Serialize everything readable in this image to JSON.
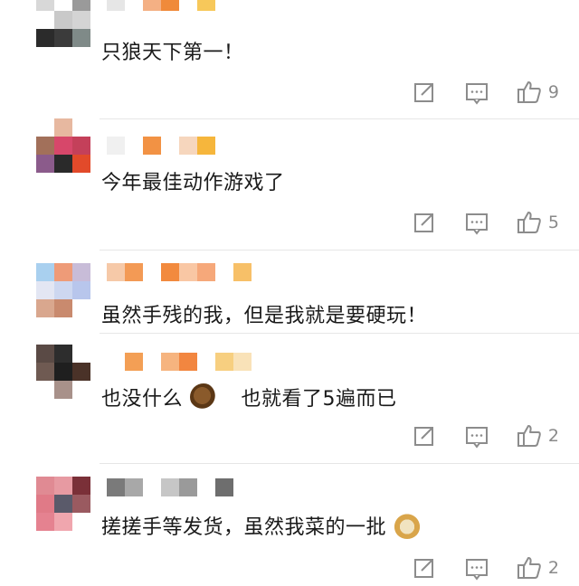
{
  "comments": [
    {
      "text": "只狼天下第一！",
      "like_count": "9",
      "emoji": "",
      "text_after": "",
      "avatar": [
        "#d8d8d8",
        "#ffffff",
        "#9a9a9a",
        "#ffffff",
        "#c9c9c9",
        "#d4d4d4",
        "#2b2b2b",
        "#3b3b3b",
        "#7f8a88"
      ],
      "name_colors": [
        "#e6e6e6",
        "#ffffff",
        "#f4b084",
        "#f08a3a",
        "#ffffff",
        "#f7c85a"
      ]
    },
    {
      "text": "今年最佳动作游戏了",
      "like_count": "5",
      "emoji": "",
      "text_after": "",
      "avatar": [
        "#ffffff",
        "#e7b8a0",
        "#ffffff",
        "#a2705a",
        "#d7476a",
        "#c4405a",
        "#8b5b8b",
        "#2a2a2a",
        "#e24a2a"
      ],
      "name_colors": [
        "#f0f0f0",
        "#ffffff",
        "#f29244",
        "#ffffff",
        "#f6d6bd",
        "#f6b63c"
      ]
    },
    {
      "text": "虽然手残的我，但是我就是要硬玩！",
      "like_count": "",
      "emoji": "",
      "text_after": "",
      "avatar": [
        "#a9d0ef",
        "#ee9b78",
        "#c8bcd8",
        "#e3e6f3",
        "#cdd7f0",
        "#b8c6ec",
        "#d9a78e",
        "#c98a6e",
        "#ffffff"
      ],
      "name_colors": [
        "#f6c9a8",
        "#f39a55",
        "#ffffff",
        "#f28a3e",
        "#f9c7a4",
        "#f6a87a",
        "#ffffff",
        "#f7c068"
      ]
    },
    {
      "text": "也没什么",
      "like_count": "2",
      "emoji": "horse",
      "text_after": "也就看了5遍而已",
      "avatar": [
        "#5a4a45",
        "#2d2d2d",
        "#ffffff",
        "#6f5a52",
        "#1f1f1f",
        "#4a3228",
        "#ffffff",
        "#a8918a",
        "#ffffff"
      ],
      "name_colors": [
        "#ffffff",
        "#f39f55",
        "#ffffff",
        "#f6b47f",
        "#f28640",
        "#ffffff",
        "#f7cf80",
        "#f9e2b8"
      ]
    },
    {
      "text": "搓搓手等发货，虽然我菜的一批",
      "like_count": "2",
      "emoji": "doge",
      "text_after": "",
      "avatar": [
        "#e08a93",
        "#e79aa2",
        "#7a3038",
        "#e07a87",
        "#5a5a6a",
        "#9a5a60",
        "#e58290",
        "#f0a6ae",
        "#ffffff"
      ],
      "name_colors": [
        "#7a7a7a",
        "#a8a8a8",
        "#ffffff",
        "#c6c6c6",
        "#9a9a9a",
        "#ffffff",
        "#6e6e6e"
      ]
    }
  ],
  "icons": {
    "share": "share-icon",
    "reply": "comment-icon",
    "like": "thumbs-up-icon"
  }
}
